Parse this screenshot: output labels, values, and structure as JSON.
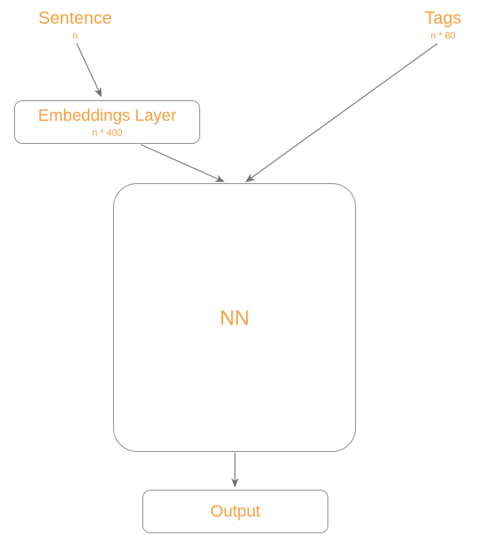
{
  "nodes": {
    "sentence": {
      "title": "Sentence",
      "subtitle": "n"
    },
    "tags": {
      "title": "Tags",
      "subtitle": "n * 80"
    },
    "embeddings": {
      "title": "Embeddings Layer",
      "subtitle": "n * 400"
    },
    "nn": {
      "title": "NN"
    },
    "output": {
      "title": "Output"
    }
  },
  "colors": {
    "accent": "#f5a142",
    "line": "#707070"
  }
}
